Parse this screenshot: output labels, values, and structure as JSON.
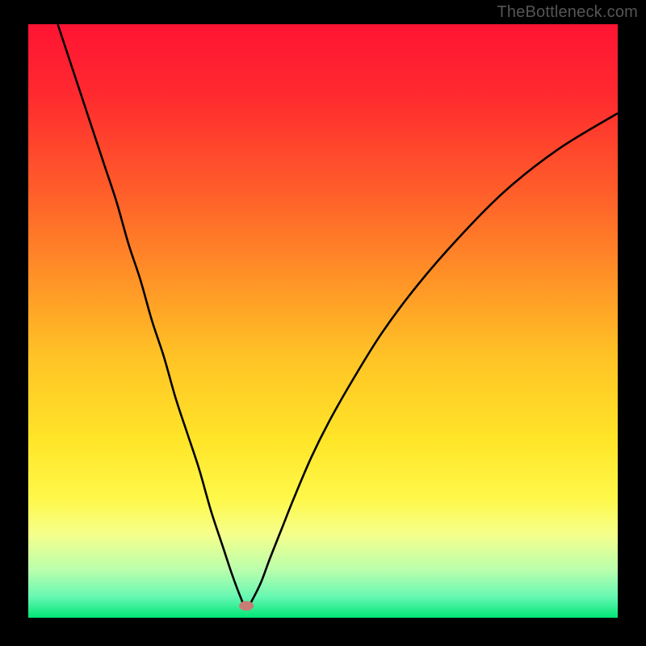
{
  "watermark": {
    "text": "TheBottleneck.com"
  },
  "chart_data": {
    "type": "line",
    "title": "",
    "xlabel": "",
    "ylabel": "",
    "xlim": [
      0,
      100
    ],
    "ylim": [
      0,
      100
    ],
    "grid": false,
    "legend": false,
    "background_gradient_stops": [
      {
        "offset": 0.0,
        "color": "#ff1433"
      },
      {
        "offset": 0.12,
        "color": "#ff2a2f"
      },
      {
        "offset": 0.28,
        "color": "#ff5d2a"
      },
      {
        "offset": 0.42,
        "color": "#ff8f27"
      },
      {
        "offset": 0.56,
        "color": "#ffc326"
      },
      {
        "offset": 0.7,
        "color": "#ffe528"
      },
      {
        "offset": 0.8,
        "color": "#fff84a"
      },
      {
        "offset": 0.86,
        "color": "#f5ff8c"
      },
      {
        "offset": 0.92,
        "color": "#b9ffad"
      },
      {
        "offset": 0.965,
        "color": "#66f7b2"
      },
      {
        "offset": 1.0,
        "color": "#00e676"
      }
    ],
    "marker": {
      "x": 37,
      "y": 2,
      "color": "#c77d74"
    },
    "series": [
      {
        "name": "curve",
        "color": "#000000",
        "width": 2.6,
        "x": [
          5,
          7,
          9,
          11,
          13,
          15,
          17,
          19,
          21,
          23,
          25,
          27,
          29,
          31,
          33,
          34.5,
          36,
          37,
          38,
          39.5,
          41,
          43,
          45,
          48,
          51,
          55,
          60,
          66,
          73,
          81,
          90,
          100
        ],
        "y": [
          100,
          94,
          88,
          82,
          76,
          70,
          63,
          57,
          50,
          44,
          37,
          31,
          25,
          18,
          12,
          7.5,
          3.5,
          1.5,
          3,
          6,
          10,
          15,
          20,
          27,
          33,
          40,
          48,
          56,
          64,
          72,
          79,
          85
        ]
      }
    ]
  }
}
